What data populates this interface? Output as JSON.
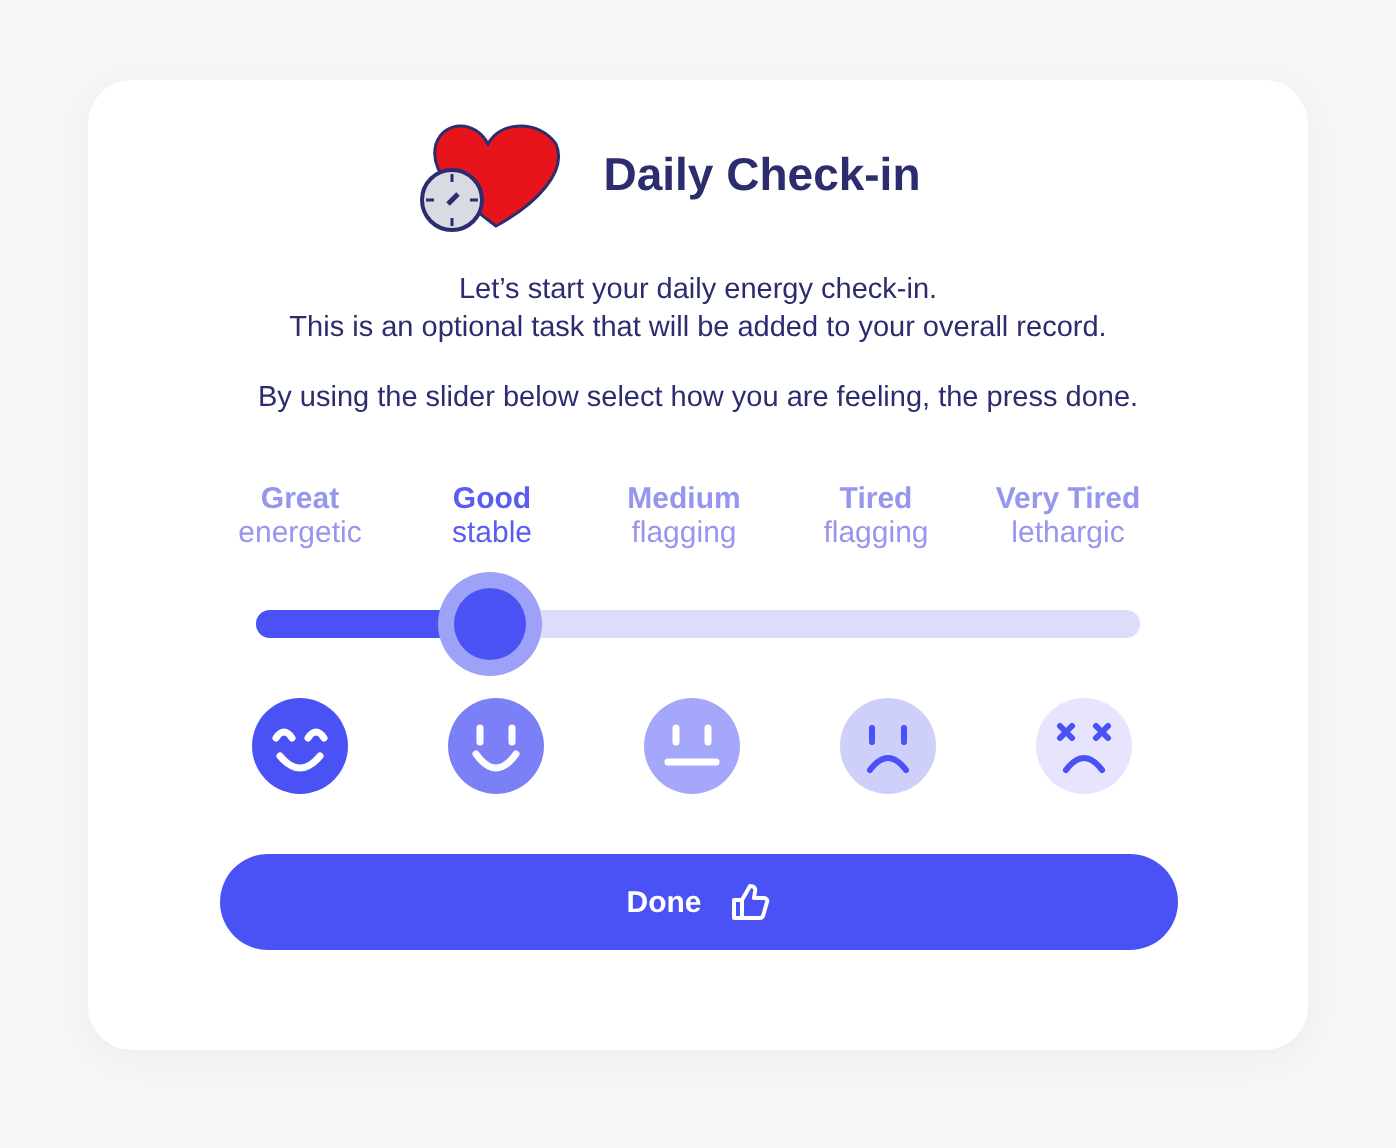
{
  "header": {
    "title": "Daily Check-in"
  },
  "intro": [
    "Let’s start your daily energy check-in.",
    "This is an optional task that will be added to your overall record."
  ],
  "instruction": "By using the slider below select how you are feeling, the press done.",
  "options": [
    {
      "label": "Great",
      "sublabel": "energetic",
      "selected": false,
      "kind": "grin",
      "color": "#4a52f5"
    },
    {
      "label": "Good",
      "sublabel": "stable",
      "selected": true,
      "kind": "smile",
      "color": "#7b80f7"
    },
    {
      "label": "Medium",
      "sublabel": "flagging",
      "selected": false,
      "kind": "neutral",
      "color": "#a5a8fa"
    },
    {
      "label": "Tired",
      "sublabel": "flagging",
      "selected": false,
      "kind": "frown",
      "color": "#cfcffb"
    },
    {
      "label": "Very Tired",
      "sublabel": "lethargic",
      "selected": false,
      "kind": "dizzy",
      "color": "#e6e5fd"
    }
  ],
  "slider": {
    "level": 0.265
  },
  "done_button": {
    "label": "Done"
  }
}
